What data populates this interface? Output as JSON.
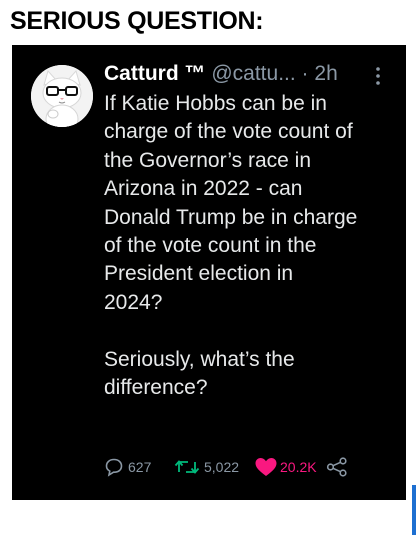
{
  "meme": {
    "title": "SERIOUS QUESTION:"
  },
  "tweet": {
    "author": {
      "display_name": "Catturd ™",
      "handle": "@cattu...",
      "avatar_icon": "cat-with-glasses-avatar"
    },
    "separator": "·",
    "time": "2h",
    "more_icon": "vertical-dots-icon",
    "text_lines": [
      "If Katie Hobbs can be in",
      "charge of the vote count of",
      "the Governor’s race in",
      "Arizona in 2022 - can",
      "Donald Trump be in charge",
      "of the vote count in the",
      "President election in",
      "2024?"
    ],
    "text_lines_2": [
      "Seriously, what’s the",
      "difference?"
    ],
    "actions": {
      "reply": {
        "icon": "reply-bubble-icon",
        "count": "627"
      },
      "retweet": {
        "icon": "retweet-icon",
        "count": "5,022",
        "color": "#00ba7c"
      },
      "like": {
        "icon": "heart-icon",
        "count": "20.2K",
        "color": "#f91880"
      },
      "share": {
        "icon": "share-icon"
      }
    }
  },
  "colors": {
    "tweet_bg": "#000000",
    "text": "#e7e9ea",
    "muted": "#8b98a5"
  }
}
